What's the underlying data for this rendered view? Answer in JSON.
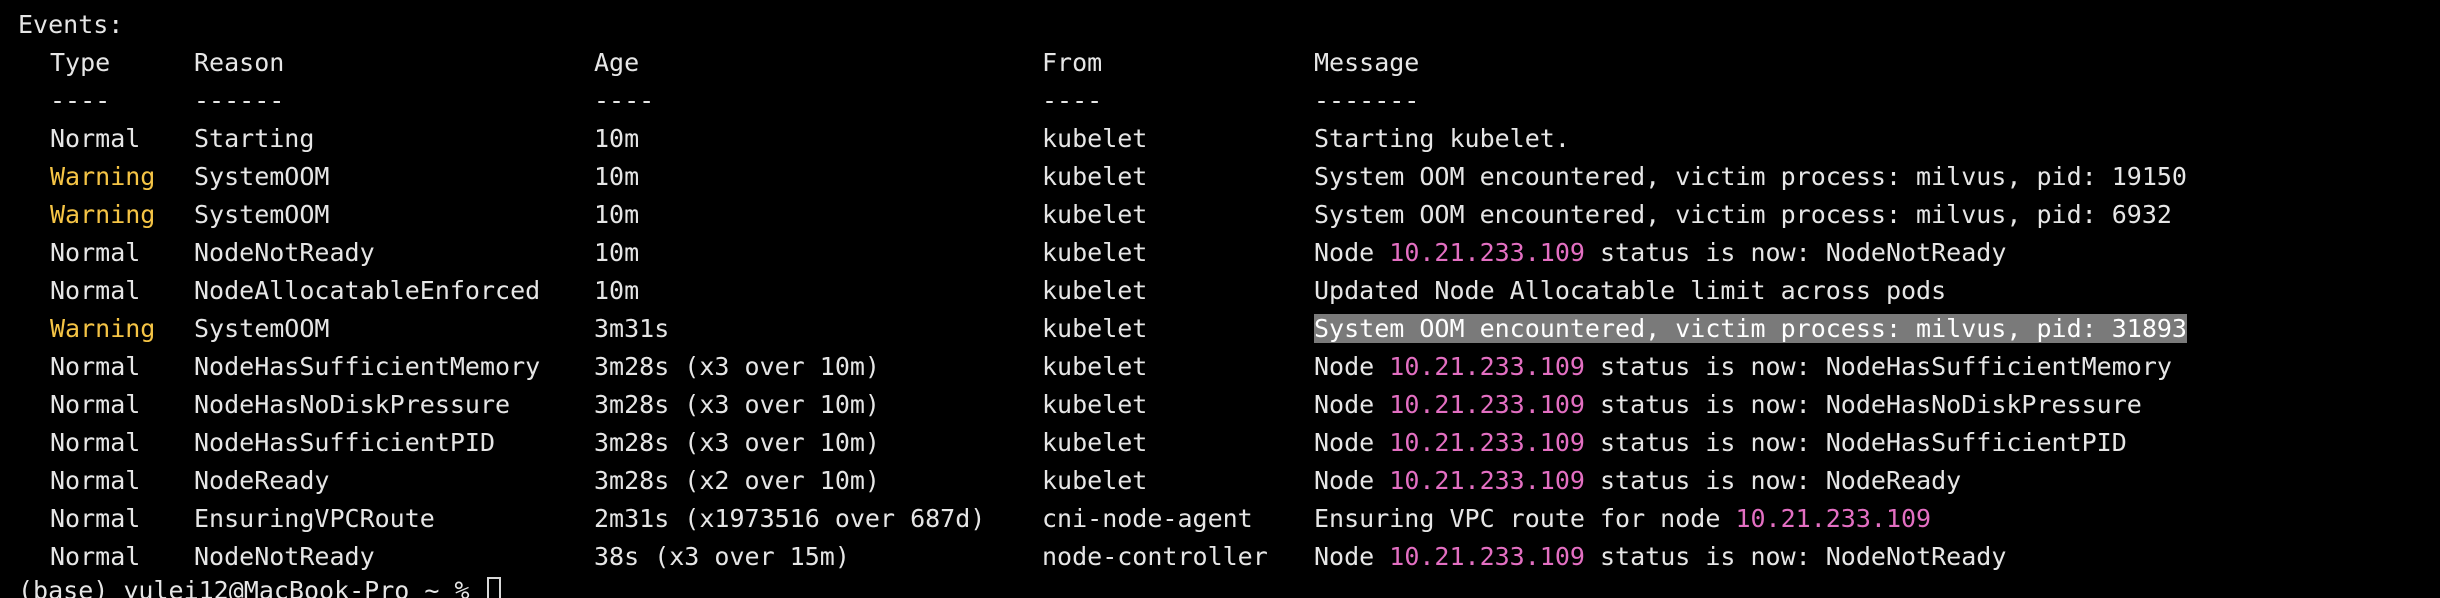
{
  "terminal": {
    "previous_line_fragment": "-------",
    "section_title": "Events:",
    "colors": {
      "background": "#000000",
      "text": "#e6e6e6",
      "warning": "#f5c445",
      "ip": "#e36fc2",
      "selection": "#7a7a7a"
    },
    "headers": {
      "type": "Type",
      "reason": "Reason",
      "age": "Age",
      "from": "From",
      "message": "Message"
    },
    "separators": {
      "type": "----",
      "reason": "------",
      "age": "----",
      "from": "----",
      "message": "-------"
    },
    "events": [
      {
        "type": "Normal",
        "reason": "Starting",
        "age": "10m",
        "from": "kubelet",
        "message_prefix": "Starting kubelet.",
        "ip": "",
        "message_suffix": ""
      },
      {
        "type": "Warning",
        "reason": "SystemOOM",
        "age": "10m",
        "from": "kubelet",
        "message_prefix": "System OOM encountered, victim process: milvus, pid: 19150",
        "ip": "",
        "message_suffix": ""
      },
      {
        "type": "Warning",
        "reason": "SystemOOM",
        "age": "10m",
        "from": "kubelet",
        "message_prefix": "System OOM encountered, victim process: milvus, pid: 6932",
        "ip": "",
        "message_suffix": ""
      },
      {
        "type": "Normal",
        "reason": "NodeNotReady",
        "age": "10m",
        "from": "kubelet",
        "message_prefix": "Node ",
        "ip": "10.21.233.109",
        "message_suffix": " status is now: NodeNotReady"
      },
      {
        "type": "Normal",
        "reason": "NodeAllocatableEnforced",
        "age": "10m",
        "from": "kubelet",
        "message_prefix": "Updated Node Allocatable limit across pods",
        "ip": "",
        "message_suffix": ""
      },
      {
        "type": "Warning",
        "reason": "SystemOOM",
        "age": "3m31s",
        "from": "kubelet",
        "message_prefix": "System OOM encountered, victim process: milvus, pid: 31893",
        "ip": "",
        "message_suffix": "",
        "selected": true
      },
      {
        "type": "Normal",
        "reason": "NodeHasSufficientMemory",
        "age": "3m28s (x3 over 10m)",
        "from": "kubelet",
        "message_prefix": "Node ",
        "ip": "10.21.233.109",
        "message_suffix": " status is now: NodeHasSufficientMemory"
      },
      {
        "type": "Normal",
        "reason": "NodeHasNoDiskPressure",
        "age": "3m28s (x3 over 10m)",
        "from": "kubelet",
        "message_prefix": "Node ",
        "ip": "10.21.233.109",
        "message_suffix": " status is now: NodeHasNoDiskPressure"
      },
      {
        "type": "Normal",
        "reason": "NodeHasSufficientPID",
        "age": "3m28s (x3 over 10m)",
        "from": "kubelet",
        "message_prefix": "Node ",
        "ip": "10.21.233.109",
        "message_suffix": " status is now: NodeHasSufficientPID"
      },
      {
        "type": "Normal",
        "reason": "NodeReady",
        "age": "3m28s (x2 over 10m)",
        "from": "kubelet",
        "message_prefix": "Node ",
        "ip": "10.21.233.109",
        "message_suffix": " status is now: NodeReady"
      },
      {
        "type": "Normal",
        "reason": "EnsuringVPCRoute",
        "age": "2m31s (x1973516 over 687d)",
        "from": "cni-node-agent",
        "message_prefix": "Ensuring VPC route for node ",
        "ip": "10.21.233.109",
        "message_suffix": ""
      },
      {
        "type": "Normal",
        "reason": "NodeNotReady",
        "age": "38s (x3 over 15m)",
        "from": "node-controller",
        "message_prefix": "Node ",
        "ip": "10.21.233.109",
        "message_suffix": " status is now: NodeNotReady"
      }
    ],
    "prompt": "(base) yulei12@MacBook-Pro ~ %"
  }
}
